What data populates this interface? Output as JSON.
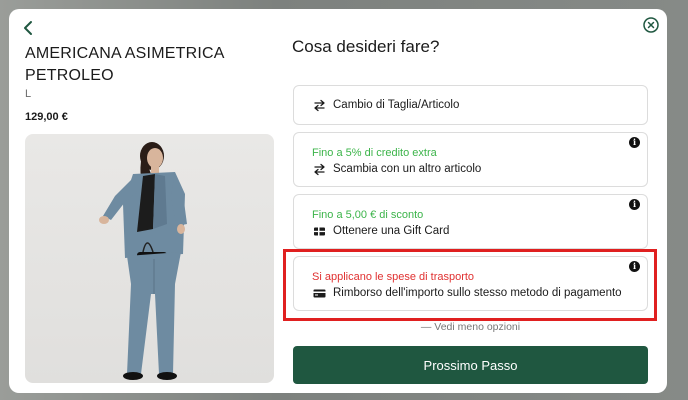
{
  "product": {
    "title": "AMERICANA ASIMETRICA PETROLEO",
    "size": "L",
    "price": "129,00 €"
  },
  "question": "Cosa desideri fare?",
  "options": [
    {
      "label": "Cambio di Taglia/Articolo",
      "sub": "",
      "icon": "swap-icon"
    },
    {
      "label": "Scambia con un altro articolo",
      "sub": "Fino a 5% di credito extra",
      "icon": "swap-icon",
      "sub_color": "#3cb44a"
    },
    {
      "label": "Ottenere una Gift Card",
      "sub": "Fino a 5,00 € di sconto",
      "icon": "gift-card-icon",
      "sub_color": "#3cb44a"
    },
    {
      "label": "Rimborso dell'importo sullo stesso metodo di pagamento",
      "sub": "Si applicano le spese di trasporto",
      "icon": "credit-card-icon",
      "sub_color": "#e03030"
    }
  ],
  "info_glyph": "i",
  "less_options": "— Vedi meno opzioni",
  "next_button": "Prossimo Passo",
  "colors": {
    "primary": "#1f5740",
    "green_text": "#3cb44a",
    "red_text": "#e03030",
    "highlight": "#e02020"
  }
}
